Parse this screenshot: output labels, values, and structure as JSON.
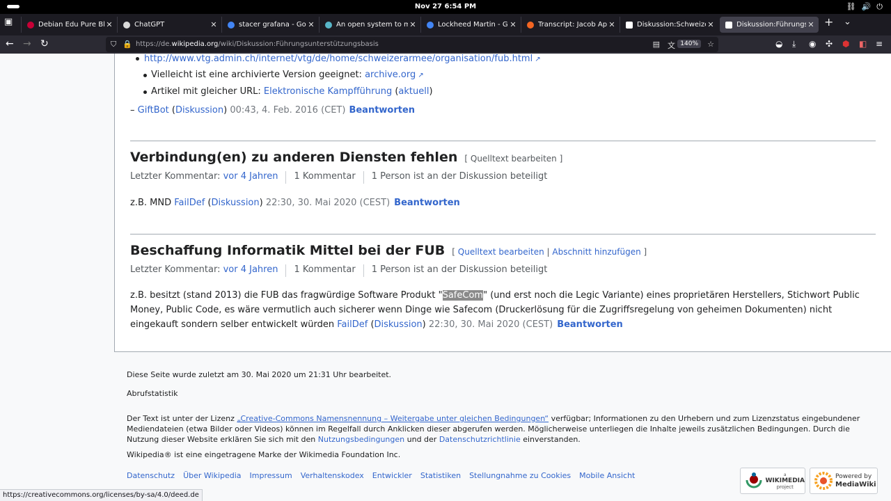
{
  "system": {
    "clock": "Nov 27   6:54 PM"
  },
  "tabs": [
    {
      "title": "Debian Edu Pure Blend",
      "favicon_color": "#c70036"
    },
    {
      "title": "ChatGPT",
      "favicon_color": "#d9d9d9"
    },
    {
      "title": "stacer grafana - Google",
      "favicon_color": "#4285f4"
    },
    {
      "title": "An open system to mana",
      "favicon_color": "#58b6c8"
    },
    {
      "title": "Lockheed Martin - Goog",
      "favicon_color": "#4285f4"
    },
    {
      "title": "Transcript: Jacob Appel",
      "favicon_color": "#f26522"
    },
    {
      "title": "Diskussion:Schweizer N",
      "favicon_color": "#ffffff"
    },
    {
      "title": "Diskussion:Führungsunt",
      "favicon_color": "#ffffff"
    }
  ],
  "address": {
    "prefix": "https://de.",
    "domain": "wikipedia.org",
    "path": "/wiki/Diskussion:Führungsunterstützungsbasis",
    "zoom": "140%"
  },
  "thread1": {
    "url_link": "http://www.vtg.admin.ch/internet/vtg/de/home/schweizerarmee/organisation/fub.html",
    "archive_text": "Vielleicht ist eine archivierte Version geeignet: ",
    "archive_link": "archive.org",
    "same_url_text": "Artikel mit gleicher URL: ",
    "same_url_link": "Elektronische Kampfführung",
    "same_url_open": " (",
    "same_url_paren": "aktuell",
    "same_url_close": ")",
    "sig_dash": "– ",
    "sig_user": "GiftBot",
    "sig_open": " (",
    "sig_talk": "Diskussion",
    "sig_close": ") ",
    "sig_time": "00:43, 4. Feb. 2016 (CET)",
    "reply": "Beantworten"
  },
  "section2": {
    "title": "Verbindung(en) zu anderen Diensten fehlen",
    "edit": "[ Quelltext bearbeiten ]",
    "last_comment_label": "Letzter Kommentar: ",
    "last_comment_link": "vor 4 Jahren",
    "comments": "1 Kommentar",
    "people": "1 Person ist an der Diskussion beteiligt",
    "body": "z.B. MND ",
    "user": "FailDef",
    "talk_open": " (",
    "talk": "Diskussion",
    "talk_close": ") ",
    "time": "22:30, 30. Mai 2020 (CEST)",
    "reply": "Beantworten"
  },
  "section3": {
    "title": "Beschaffung Informatik Mittel bei der FUB",
    "edit_open": "[ ",
    "edit_link": "Quelltext bearbeiten",
    "edit_sep": " | ",
    "add_link": "Abschnitt hinzufügen",
    "edit_close": " ]",
    "last_comment_label": "Letzter Kommentar: ",
    "last_comment_link": "vor 4 Jahren",
    "comments": "1 Kommentar",
    "people": "1 Person ist an der Diskussion beteiligt",
    "body_before": "z.B. besitzt (stand 2013) die FUB das fragwürdige Software Produkt \"",
    "body_highlight": "SafeCom",
    "body_after": "\" (und erst noch die Legic Variante) eines proprietären Herstellers, Stichwort Public Money, Public Code, es wäre vermutlich auch sicherer wenn Dinge wie Safecom (Druckerlösung für die Zugriffsregelung von geheimen Dokumenten) nicht eingekauft sondern selber entwickelt würden ",
    "user": "FailDef",
    "talk_open": " (",
    "talk": "Diskussion",
    "talk_close": ") ",
    "time": "22:30, 30. Mai 2020 (CEST)",
    "reply": "Beantworten"
  },
  "footer": {
    "last_edit": "Diese Seite wurde zuletzt am 30. Mai 2020 um 21:31 Uhr bearbeitet.",
    "stats": "Abrufstatistik",
    "license_a": "Der Text ist unter der Lizenz ",
    "license_link": "„Creative-Commons Namensnennung – Weitergabe unter gleichen Bedingungen“",
    "license_b": " verfügbar; Informationen zu den Urhebern und zum Lizenzstatus eingebundener Mediendateien (etwa Bilder oder Videos) können im Regelfall durch Anklicken dieser abgerufen werden. Möglicherweise unterliegen die Inhalte jeweils zusätzlichen Bedingungen. Durch die Nutzung dieser Website erklären Sie sich mit den ",
    "terms_link": "Nutzungsbedingungen",
    "license_c": " und der ",
    "privacy_link": "Datenschutzrichtlinie",
    "license_d": " einverstanden.",
    "trademark": "Wikipedia® ist eine eingetragene Marke der Wikimedia Foundation Inc.",
    "links": [
      "Datenschutz",
      "Über Wikipedia",
      "Impressum",
      "Verhaltenskodex",
      "Entwickler",
      "Statistiken",
      "Stellungnahme zu Cookies",
      "Mobile Ansicht"
    ],
    "wikimedia_small": "a",
    "wikimedia_name": "WIKIMEDIA",
    "wikimedia_sub": "project",
    "mediawiki_top": "Powered by",
    "mediawiki_name": "MediaWiki"
  },
  "status_url": "https://creativecommons.org/licenses/by-sa/4.0/deed.de"
}
